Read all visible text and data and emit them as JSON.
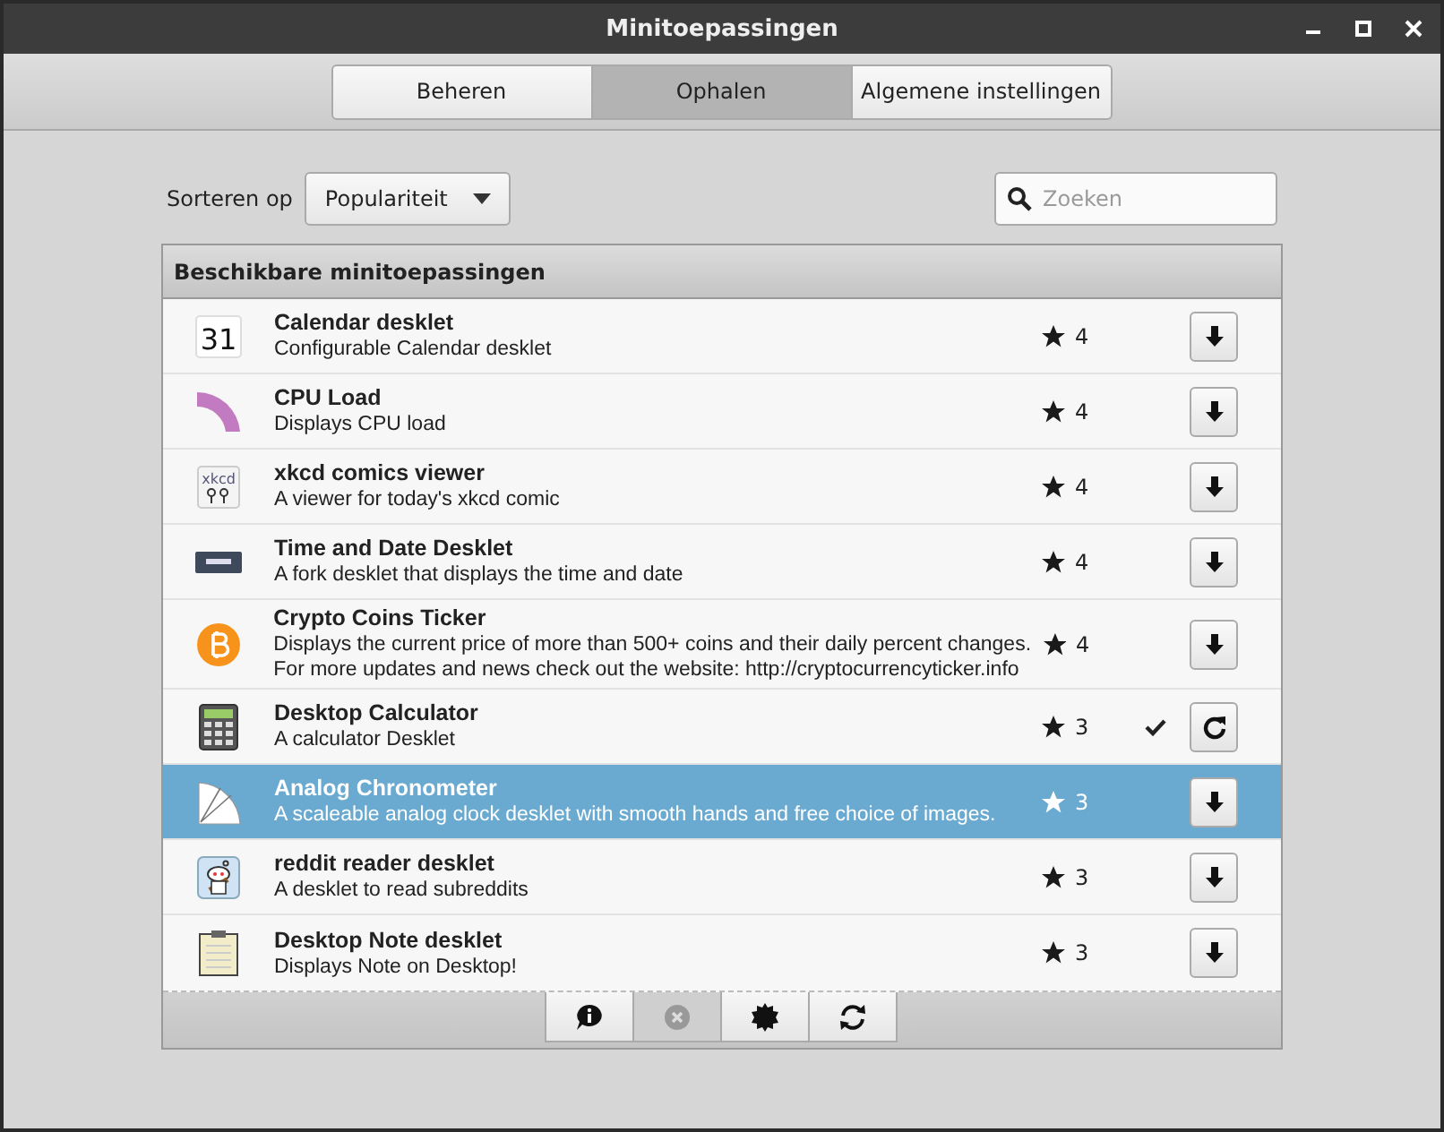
{
  "window": {
    "title": "Minitoepassingen"
  },
  "tabs": [
    {
      "label": "Beheren",
      "selected": false
    },
    {
      "label": "Ophalen",
      "selected": true
    },
    {
      "label": "Algemene instellingen",
      "selected": false
    }
  ],
  "sort": {
    "label": "Sorteren op",
    "value": "Populariteit"
  },
  "search": {
    "placeholder": "Zoeken"
  },
  "list": {
    "header": "Beschikbare minitoepassingen",
    "rows": [
      {
        "title": "Calendar desklet",
        "icon_label": "31",
        "description": [
          "Configurable Calendar desklet"
        ],
        "score": "4",
        "installed": false,
        "kind": "download",
        "selected": false
      },
      {
        "title": "CPU Load",
        "description": [
          "Displays CPU load"
        ],
        "score": "4",
        "installed": false,
        "kind": "download",
        "selected": false
      },
      {
        "title": "xkcd comics viewer",
        "icon_label": "xkcd",
        "description": [
          "A viewer for today's xkcd comic"
        ],
        "score": "4",
        "installed": false,
        "kind": "download",
        "selected": false
      },
      {
        "title": "Time and Date Desklet",
        "description": [
          "A fork desklet that displays the time and date"
        ],
        "score": "4",
        "installed": false,
        "kind": "download",
        "selected": false
      },
      {
        "title": "Crypto Coins Ticker",
        "description": [
          "Displays the current price of more than 500+ coins and their daily percent changes.",
          "For more updates and news check out the website: http://cryptocurrencyticker.info"
        ],
        "score": "4",
        "installed": false,
        "kind": "download",
        "selected": false
      },
      {
        "title": "Desktop Calculator",
        "description": [
          "A calculator Desklet"
        ],
        "score": "3",
        "installed": true,
        "kind": "update",
        "selected": false
      },
      {
        "title": "Analog Chronometer",
        "description": [
          "A scaleable analog clock desklet with smooth hands and free choice of images."
        ],
        "score": "3",
        "installed": false,
        "kind": "download",
        "selected": true
      },
      {
        "title": "reddit reader desklet",
        "description": [
          "A desklet to read subreddits"
        ],
        "score": "3",
        "installed": false,
        "kind": "download",
        "selected": false
      },
      {
        "title": "Desktop Note desklet",
        "description": [
          "Displays Note on Desktop!"
        ],
        "score": "3",
        "installed": false,
        "kind": "download",
        "selected": false
      }
    ]
  },
  "footer_buttons": [
    {
      "kind": "info",
      "disabled": false
    },
    {
      "kind": "remove",
      "disabled": true
    },
    {
      "kind": "settings",
      "disabled": false
    },
    {
      "kind": "refresh",
      "disabled": false
    }
  ]
}
